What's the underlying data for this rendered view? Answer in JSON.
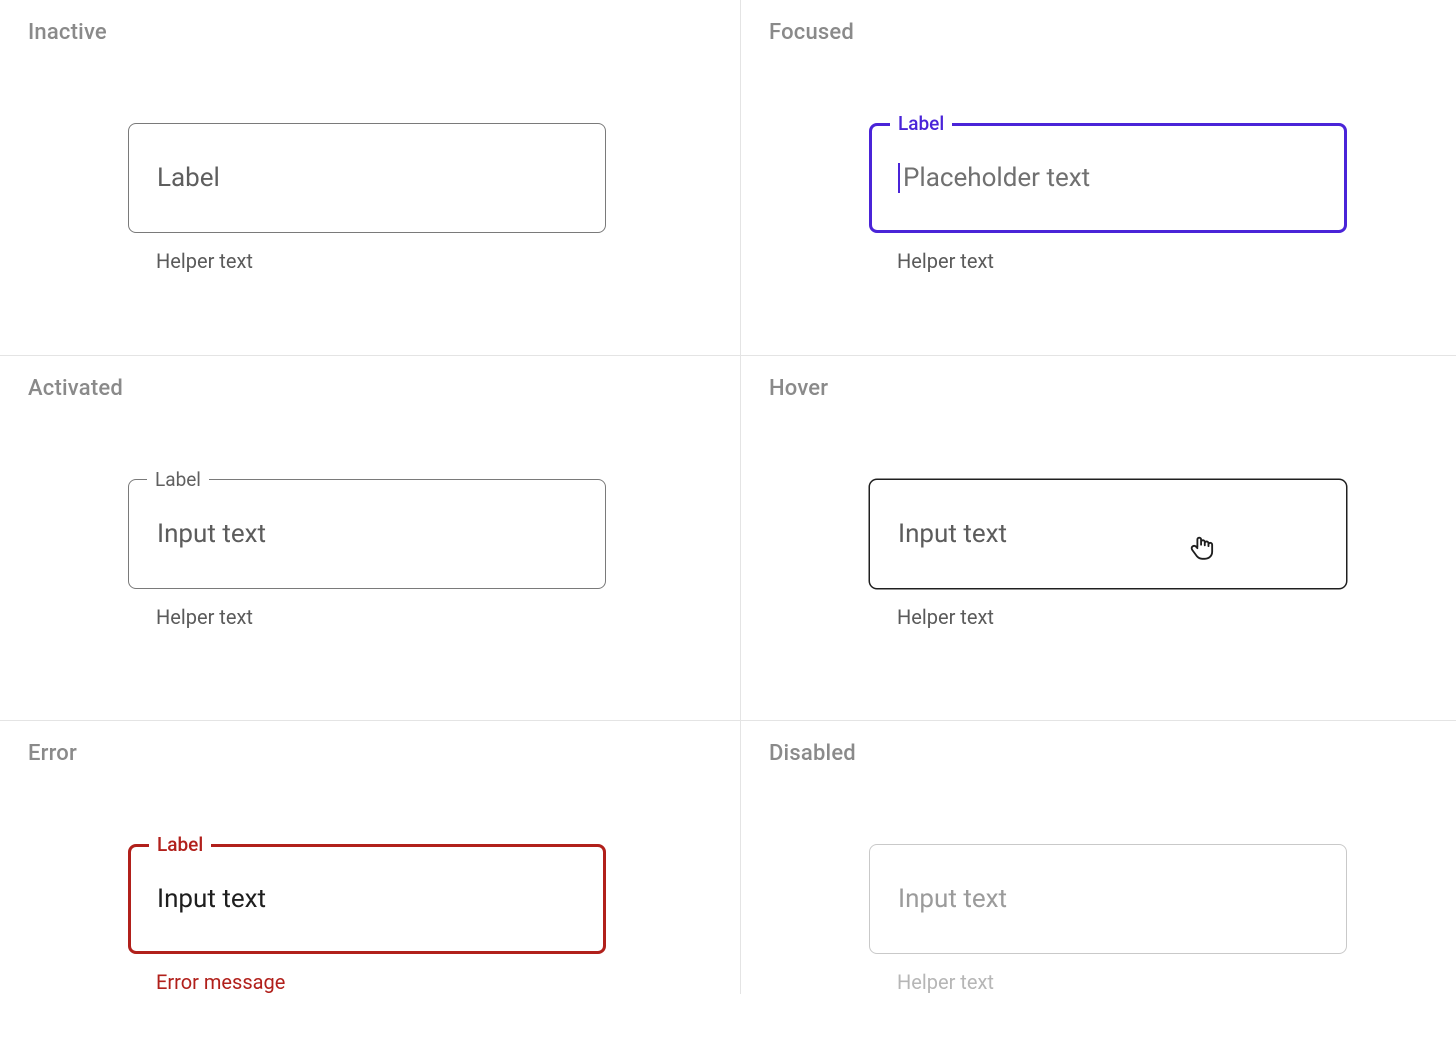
{
  "colors": {
    "focus": "#4a24d8",
    "error": "#b1201b",
    "border_default": "#7a7a7a",
    "border_hover": "#202020",
    "border_disabled": "#c9c9c9",
    "text_muted": "#8a8a8a"
  },
  "states": {
    "inactive": {
      "title": "Inactive",
      "label": "Label",
      "helper": "Helper text"
    },
    "focused": {
      "title": "Focused",
      "float_label": "Label",
      "placeholder": "Placeholder text",
      "helper": "Helper text"
    },
    "activated": {
      "title": "Activated",
      "float_label": "Label",
      "value": "Input text",
      "helper": "Helper text"
    },
    "hover": {
      "title": "Hover",
      "value": "Input text",
      "helper": "Helper text"
    },
    "error": {
      "title": "Error",
      "float_label": "Label",
      "value": "Input text",
      "helper": "Error message"
    },
    "disabled": {
      "title": "Disabled",
      "value": "Input text",
      "helper": "Helper text"
    }
  }
}
